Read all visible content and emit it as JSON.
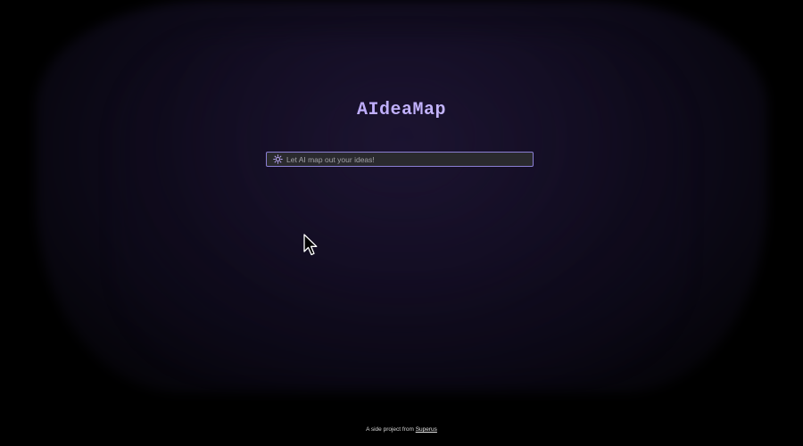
{
  "app": {
    "title": "AIdeaMap"
  },
  "search": {
    "placeholder": "Let AI map out your ideas!",
    "value": "",
    "icon": "sparkle-gear-icon"
  },
  "footer": {
    "prefix": "A side project from",
    "link_label": "Superus"
  },
  "colors": {
    "accent": "#a78bfa",
    "input_border": "#8b7fd4",
    "background": "#000000"
  }
}
